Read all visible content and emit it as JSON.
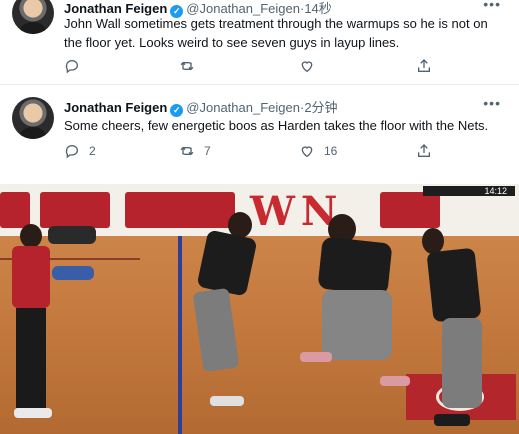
{
  "tweets": [
    {
      "author": "Jonathan Feigen",
      "handle": "@Jonathan_Feigen",
      "time": "14秒",
      "text": "John Wall sometimes gets treatment through the warmups so he is not on the floor yet. Looks weird to see seven guys in layup lines.",
      "reply_count": "",
      "retweet_count": "",
      "like_count": ""
    },
    {
      "author": "Jonathan Feigen",
      "handle": "@Jonathan_Feigen",
      "time": "2分钟",
      "text": "Some cheers, few energetic boos as Harden takes the floor with the Nets.",
      "reply_count": "2",
      "retweet_count": "7",
      "like_count": "16"
    }
  ],
  "icons": {
    "verified": "verified-badge-icon",
    "more": "more-options-icon",
    "reply": "reply-icon",
    "retweet": "retweet-icon",
    "like": "like-icon",
    "share": "share-icon"
  },
  "symbols": {
    "dot": "·",
    "more": "•••",
    "check": "✓"
  },
  "photo": {
    "scoreboard": "14:12",
    "colors": {
      "board_red": "#b7232c",
      "floor": "#c47a3e",
      "court_line": "#2e3f9a",
      "nets_jersey": "#1c1c1c",
      "rockets_red": "#b7232c"
    }
  },
  "colors": {
    "accent": "#1d9bf0",
    "muted": "#536471",
    "text": "#0f1419",
    "divider": "#e6ecf0"
  }
}
